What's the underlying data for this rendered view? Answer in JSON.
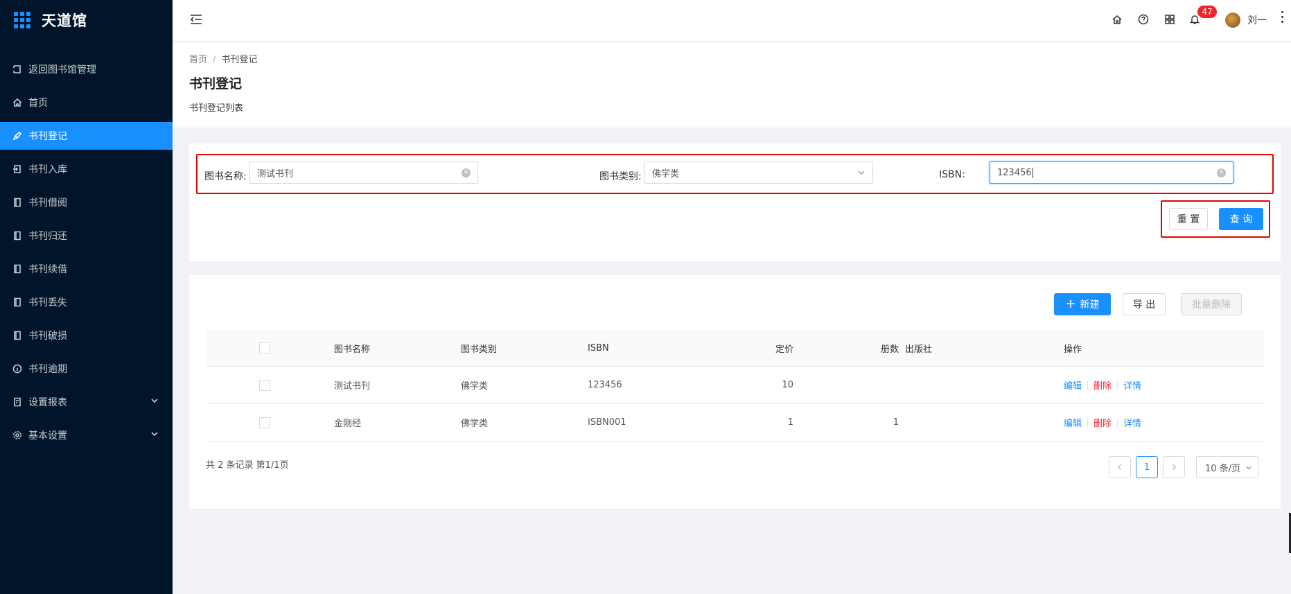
{
  "app": {
    "title": "天道馆"
  },
  "sidebar": {
    "items": [
      {
        "label": "返回图书馆管理",
        "icon": "return-icon"
      },
      {
        "label": "首页",
        "icon": "home-icon"
      },
      {
        "label": "书刊登记",
        "icon": "pen-icon",
        "active": true
      },
      {
        "label": "书刊入库",
        "icon": "import-icon"
      },
      {
        "label": "书刊借阅",
        "icon": "book-icon"
      },
      {
        "label": "书刊归还",
        "icon": "book-icon"
      },
      {
        "label": "书刊续借",
        "icon": "book-icon"
      },
      {
        "label": "书刊丢失",
        "icon": "book-icon"
      },
      {
        "label": "书刊破损",
        "icon": "book-icon"
      },
      {
        "label": "书刊逾期",
        "icon": "info-circle-icon"
      },
      {
        "label": "设置报表",
        "icon": "report-icon",
        "has_submenu": true
      },
      {
        "label": "基本设置",
        "icon": "gear-icon",
        "has_submenu": true
      }
    ]
  },
  "header": {
    "notification_count": "47",
    "user_name": "刘一"
  },
  "breadcrumb": {
    "home": "首页",
    "current": "书刊登记"
  },
  "page": {
    "title": "书刊登记",
    "description": "书刊登记列表"
  },
  "search": {
    "book_name_label": "图书名称:",
    "book_name_value": "测试书刊",
    "category_label": "图书类别:",
    "category_value": "佛学类",
    "isbn_label": "ISBN:",
    "isbn_value": "123456",
    "reset_label": "重 置",
    "query_label": "查 询"
  },
  "toolbar": {
    "new_label": "新建",
    "export_label": "导 出",
    "batch_delete_label": "批量删除"
  },
  "table": {
    "columns": [
      "图书名称",
      "图书类别",
      "ISBN",
      "定价",
      "册数",
      "出版社",
      "操作"
    ],
    "rows": [
      {
        "name": "测试书刊",
        "category": "佛学类",
        "isbn": "123456",
        "price": "10",
        "copies": "",
        "publisher": ""
      },
      {
        "name": "金刚经",
        "category": "佛学类",
        "isbn": "ISBN001",
        "price": "1",
        "copies": "1",
        "publisher": ""
      }
    ],
    "actions": {
      "edit": "编辑",
      "delete": "删除",
      "detail": "详情"
    }
  },
  "pagination": {
    "summary": "共 2 条记录 第1/1页",
    "current_page": "1",
    "page_size": "10 条/页"
  },
  "colors": {
    "primary": "#1890ff",
    "sidebar_bg": "#001529",
    "danger": "#f5222d",
    "highlight_box": "#e60000"
  }
}
